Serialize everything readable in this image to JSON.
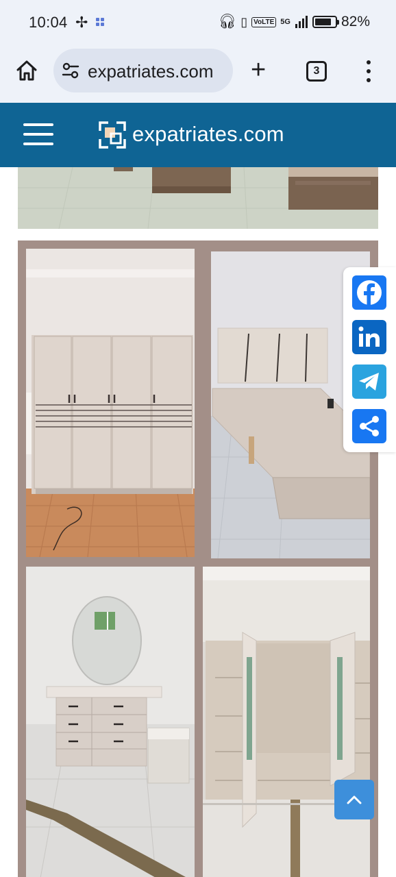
{
  "status_bar": {
    "time": "10:04",
    "volte_badge": "VoLTE",
    "network": "5G",
    "battery_percent": "82%",
    "battery_level": 0.82
  },
  "browser": {
    "url_text": "expatriates.com",
    "tab_count": "3"
  },
  "site": {
    "name": "expatriates.com",
    "header_color": "#0f6494"
  },
  "share": {
    "items": [
      {
        "name": "facebook",
        "color": "#1877f2"
      },
      {
        "name": "linkedin",
        "color": "#0a66c2"
      },
      {
        "name": "telegram",
        "color": "#2aa3df"
      },
      {
        "name": "share",
        "color": "#1877f2"
      }
    ]
  },
  "icons": {
    "home": "home-icon",
    "site_info": "tune-icon",
    "new_tab": "plus-icon",
    "tabs": "tabs-icon",
    "menu": "more-vert-icon",
    "scroll_top": "chevron-up-icon"
  }
}
